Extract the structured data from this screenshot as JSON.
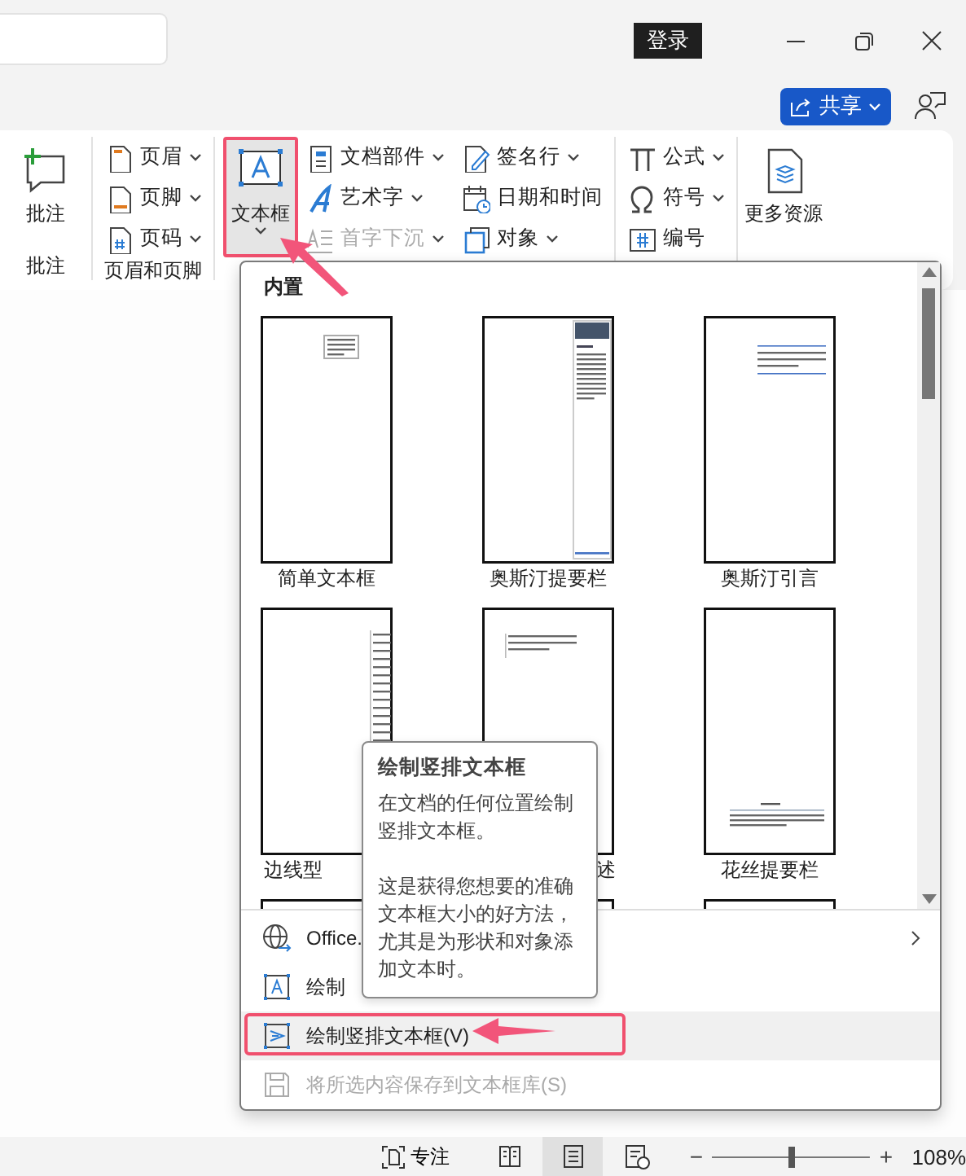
{
  "title_bar": {
    "sign_in_button": "登录"
  },
  "share_button": {
    "label": "共享",
    "dropdown": true
  },
  "ribbon": {
    "groups": [
      {
        "label": "批注",
        "items": [
          {
            "kind": "large",
            "label": "批注",
            "dropdown": false
          }
        ]
      },
      {
        "label": "页眉和页脚",
        "items": [
          {
            "kind": "small",
            "label": "页眉",
            "dropdown": true,
            "disabled": false
          },
          {
            "kind": "small",
            "label": "页脚",
            "dropdown": true,
            "disabled": false
          },
          {
            "kind": "small",
            "label": "页码",
            "dropdown": true,
            "disabled": false
          }
        ]
      },
      {
        "items": [
          {
            "kind": "large",
            "label": "文本框",
            "dropdown": true,
            "pressed": true,
            "highlighted": true
          },
          {
            "kind": "small",
            "label": "文档部件",
            "dropdown": true,
            "disabled": false
          },
          {
            "kind": "small",
            "label": "艺术字",
            "dropdown": true,
            "disabled": false
          },
          {
            "kind": "small",
            "label": "首字下沉",
            "dropdown": true,
            "disabled": true
          },
          {
            "kind": "small",
            "label": "签名行",
            "dropdown": true,
            "disabled": false
          },
          {
            "kind": "small",
            "label": "日期和时间",
            "dropdown": false,
            "disabled": false
          },
          {
            "kind": "small",
            "label": "对象",
            "dropdown": true,
            "disabled": false
          }
        ]
      },
      {
        "items": [
          {
            "kind": "small",
            "label": "公式",
            "dropdown": true,
            "disabled": false
          },
          {
            "kind": "small",
            "label": "符号",
            "dropdown": true,
            "disabled": false
          },
          {
            "kind": "small",
            "label": "编号",
            "dropdown": false,
            "disabled": false
          }
        ]
      },
      {
        "items": [
          {
            "kind": "large",
            "label": "更多资源",
            "dropdown": false
          }
        ]
      }
    ]
  },
  "menu": {
    "section_title": "内置",
    "gallery": [
      {
        "kind": "simple",
        "label": "简单文本框"
      },
      {
        "kind": "sidebar",
        "label": "奥斯汀提要栏"
      },
      {
        "kind": "quote",
        "label": "奥斯汀引言"
      },
      {
        "kind": "border-sidebar",
        "label_head": "边线型"
      },
      {
        "kind": "side-text",
        "label_tail": "述"
      },
      {
        "kind": "filigree",
        "label": "花丝提要栏"
      },
      {
        "kind": "blank"
      },
      {
        "kind": "blank"
      },
      {
        "kind": "blank"
      }
    ],
    "items": [
      {
        "kind": "globe",
        "label": "Office.",
        "submenu": true,
        "disabled": false,
        "selected": false,
        "highlighted": false
      },
      {
        "kind": "textbox",
        "label": "绘制",
        "submenu": false,
        "disabled": false,
        "selected": false,
        "highlighted": false
      },
      {
        "kind": "vertical-textbox",
        "label": "绘制竖排文本框(V)",
        "submenu": false,
        "disabled": false,
        "selected": true,
        "highlighted": true
      },
      {
        "kind": "save",
        "label": "将所选内容保存到文本框库(S)",
        "submenu": false,
        "disabled": true,
        "selected": false,
        "highlighted": false
      }
    ]
  },
  "tooltip": {
    "title": "绘制竖排文本框",
    "paragraphs": [
      "在文档的任何位置绘制竖排文本框。",
      "这是获得您想要的准确文本框大小的好方法，尤其是为形状和对象添加文本时。"
    ]
  },
  "status_bar": {
    "focus": "专注",
    "views": [
      {
        "selected": false
      },
      {
        "selected": true
      },
      {
        "selected": false
      }
    ],
    "zoom": {
      "out": "−",
      "level": 0.5,
      "in": "+",
      "reading": "108%"
    }
  }
}
